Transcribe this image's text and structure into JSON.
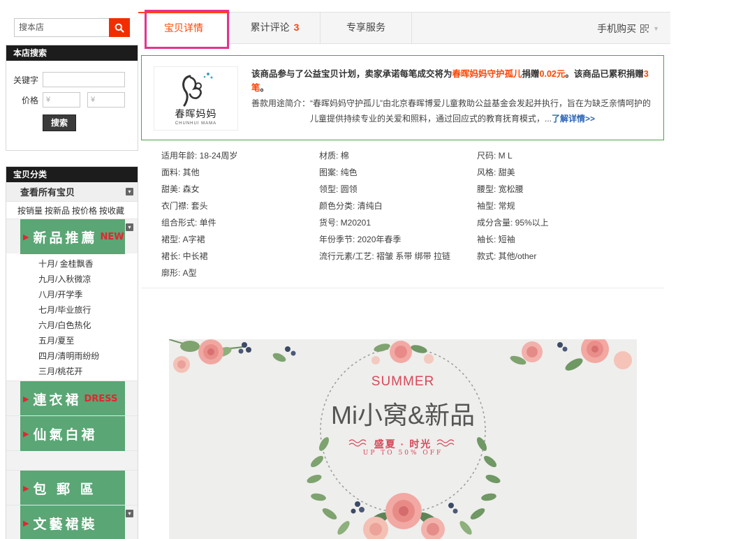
{
  "search": {
    "placeholder": "搜本店"
  },
  "store_search": {
    "title": "本店搜索",
    "keyword_label": "关键字",
    "price_label": "价格",
    "price_min_placeholder": "¥",
    "price_max_placeholder": "¥",
    "button": "搜索"
  },
  "categories": {
    "title": "宝贝分类",
    "view_all": "查看所有宝贝",
    "sort_links": [
      "按销量",
      "按新品",
      "按价格",
      "按收藏"
    ],
    "new_banner": {
      "text": "新品推薦",
      "en": "NEW"
    },
    "sub_items": [
      "十月/ 金桂飘香",
      "九月/入秋微凉",
      "八月/开学季",
      "七月/毕业旅行",
      "六月/白色热化",
      "五月/夏至",
      "四月/清明雨纷纷",
      "三月/桃花开"
    ],
    "dress_banner": {
      "text": "連衣裙",
      "en": "DRESS"
    },
    "white_banner": {
      "text": "仙氣白裙"
    },
    "ship_banner": {
      "text": "包 郵 區"
    },
    "art_banner": {
      "text": "文藝裙裝"
    }
  },
  "tabs": {
    "details": "宝贝详情",
    "reviews": "累计评论",
    "reviews_count": "3",
    "service": "专享服务",
    "mobile_buy": "手机购买"
  },
  "charity": {
    "logo_cn": "春晖妈妈",
    "logo_en": "CHUNHUI MAMA",
    "line1_a": "该商品参与了公益宝贝计划，卖家承诺每笔成交将为",
    "line1_org": "春晖妈妈守护孤儿",
    "line1_b": "捐赠",
    "line1_amount": "0.02元",
    "line1_c": "。该商品已累积捐赠",
    "line1_count": "3笔",
    "line1_d": "。",
    "desc1": "善款用途简介：“春晖妈妈守护孤儿”由北京春晖博爱儿童救助公益基金会发起并执行，旨在为缺乏亲情呵护的",
    "desc2": "儿童提供持续专业的关爱和照料，通过回应式的教育抚育模式，...",
    "learn_more": "了解详情>>"
  },
  "attributes": [
    "适用年龄: 18-24周岁",
    "材质: 棉",
    "尺码: M L",
    "面料: 其他",
    "图案: 纯色",
    "风格: 甜美",
    "甜美: 森女",
    "领型: 圆领",
    "腰型: 宽松腰",
    "衣门襟: 套头",
    "颜色分类: 清纯白",
    "袖型: 常规",
    "组合形式: 单件",
    "货号: M20201",
    "成分含量: 95%以上",
    "裙型: A字裙",
    "年份季节: 2020年春季",
    "袖长: 短袖",
    "裙长: 中长裙",
    "流行元素/工艺: 褶皱 系带 绑带 拉链",
    "款式: 其他/other",
    "廓形: A型"
  ],
  "poster": {
    "summer": "SUMMER",
    "title": "Mi小窝&新品",
    "sub": "盛夏 · 时光",
    "sub2": "UP TO 50% OFF"
  },
  "colors": {
    "accent": "#ff4400",
    "banner_green": "#5aa675",
    "charity_border": "#4ca246",
    "highlight": "#e4338d"
  }
}
